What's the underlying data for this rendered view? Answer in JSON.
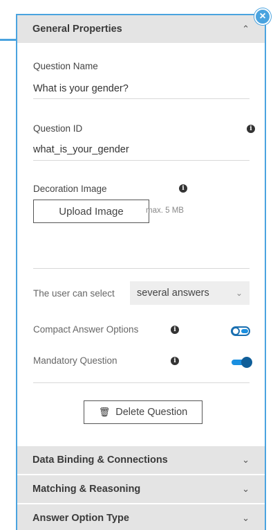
{
  "sections": {
    "general": {
      "title": "General Properties",
      "chevron": "chevron-up-icon",
      "expanded": true
    },
    "data_binding": {
      "title": "Data Binding & Connections",
      "chevron": "chevron-down-icon"
    },
    "matching": {
      "title": "Matching & Reasoning",
      "chevron": "chevron-down-icon"
    },
    "answer_type": {
      "title": "Answer Option Type",
      "chevron": "chevron-down-icon"
    }
  },
  "fields": {
    "question_name": {
      "label": "Question Name",
      "value": "What is your gender?"
    },
    "question_id": {
      "label": "Question ID",
      "value": "what_is_your_gender"
    },
    "decoration_image": {
      "label": "Decoration Image",
      "button": "Upload Image",
      "note": "max. 5 MB"
    },
    "user_select": {
      "label": "The user can select",
      "value": "several answers"
    },
    "compact": {
      "label": "Compact Answer Options",
      "on": false
    },
    "mandatory": {
      "label": "Mandatory Question",
      "on": true
    }
  },
  "actions": {
    "delete": "Delete Question"
  },
  "glyphs": {
    "chev_up": "⌃",
    "chev_down": "⌄",
    "close": "×",
    "info": "i",
    "trash": "🗑"
  },
  "colors": {
    "accent": "#4aa3df",
    "toggle": "#1a8fe0",
    "toggle_knob": "#0f5e99",
    "header_bg": "#e4e4e4"
  }
}
